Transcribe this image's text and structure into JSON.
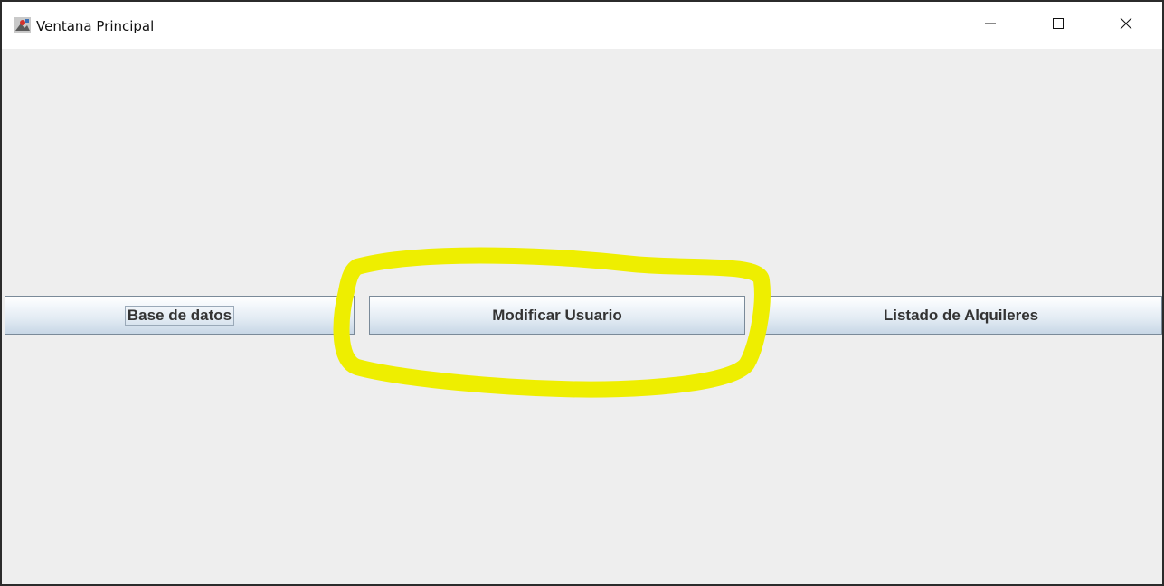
{
  "window": {
    "title": "Ventana Principal",
    "controls": {
      "minimize_icon": "minimize-icon",
      "maximize_icon": "maximize-icon",
      "close_icon": "close-icon"
    }
  },
  "buttons": {
    "base_de_datos": "Base de datos",
    "modificar_usuario": "Modificar Usuario",
    "listado_alquileres": "Listado de Alquileres"
  },
  "annotation": {
    "highlight_color": "#eeee00",
    "highlighted_element": "Modificar Usuario"
  },
  "colors": {
    "content_background": "#eeeeee",
    "titlebar_background": "#ffffff",
    "button_text": "#333333"
  }
}
